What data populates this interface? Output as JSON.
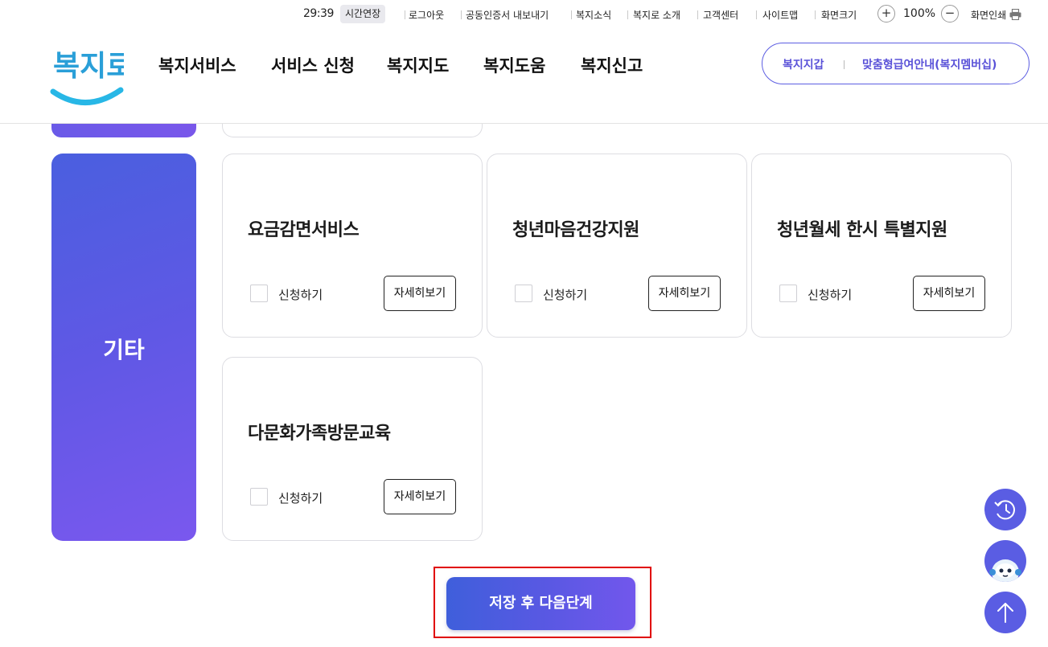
{
  "utility": {
    "timer": "29:39",
    "extend_label": "시간연장",
    "links": [
      "로그아웃",
      "공동인증서 내보내기",
      "복지소식",
      "복지로 소개",
      "고객센터",
      "사이트맵"
    ],
    "font_size_label": "화면크기",
    "zoom_in": "+",
    "zoom_level": "100%",
    "zoom_out": "−",
    "print_label": "화면인쇄"
  },
  "header": {
    "logo_text": "복지로",
    "nav": [
      "복지서비스",
      "서비스 신청",
      "복지지도",
      "복지도움",
      "복지신고"
    ],
    "pill_left": "복지지갑",
    "pill_right": "맞춤형급여안내(복지멤버십)"
  },
  "category": {
    "label": "기타",
    "color_start": "#4a5fdf",
    "color_end": "#7a58ee"
  },
  "services": [
    {
      "title": "요금감면서비스",
      "checkbox_label": "신청하기",
      "detail_label": "자세히보기",
      "checked": false
    },
    {
      "title": "청년마음건강지원",
      "checkbox_label": "신청하기",
      "detail_label": "자세히보기",
      "checked": false
    },
    {
      "title": "청년월세 한시 특별지원",
      "checkbox_label": "신청하기",
      "detail_label": "자세히보기",
      "checked": false
    },
    {
      "title": "다문화가족방문교육",
      "checkbox_label": "신청하기",
      "detail_label": "자세히보기",
      "checked": false
    }
  ],
  "submit_label": "저장 후 다음단계",
  "accent": "#5a5de3",
  "highlight_color": "#e00000",
  "floating": [
    "history-icon",
    "chatbot-icon",
    "arrow-up-icon"
  ]
}
